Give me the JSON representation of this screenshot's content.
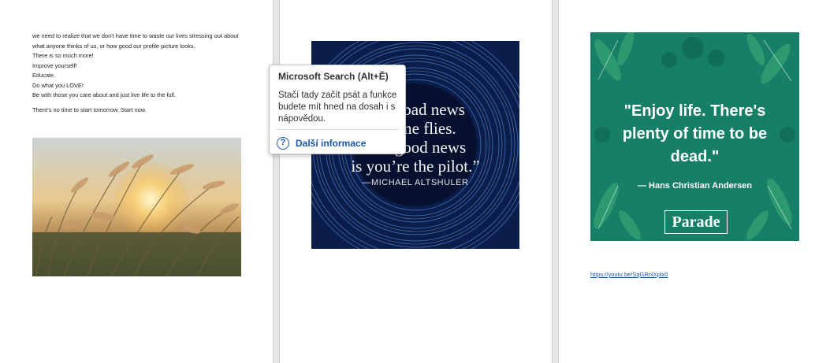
{
  "document": {
    "page1": {
      "paragraphs": [
        "we need to realize that we don't have time to waste our lives stressing out about what anyone thinks of us, or how good our profile picture looks.",
        "There is so much more!",
        "Improve yourself!",
        "Educate.",
        "Do what you LOVE!",
        "Be with those you care about and just live life to the full."
      ],
      "closing": "There's no time to start tomorrow. Start now."
    },
    "page2": {
      "quote_lines": [
        "“The bad news",
        "is time flies.",
        "The good news",
        "is you’re the pilot.”"
      ],
      "quote_author": "—MICHAEL ALTSHULER"
    },
    "page3": {
      "quote_lines": [
        "\"Enjoy life. There's",
        "plenty of time to be",
        "dead.\""
      ],
      "quote_author": "— Hans Christian Andersen",
      "brand": "Parade",
      "link": "https://youtu.be/SqGRnlXplx0"
    }
  },
  "tooltip": {
    "title": "Microsoft Search (Alt+Ě)",
    "description": "Stačí tady začít psát a funkce budete mít hned na dosah i s nápovědou.",
    "link_label": "Další informace",
    "help_icon": "question-circle-icon"
  },
  "colors": {
    "link": "#1a56a8",
    "quote1_bg": "#0a1a3f",
    "quote2_bg": "#177f68"
  }
}
